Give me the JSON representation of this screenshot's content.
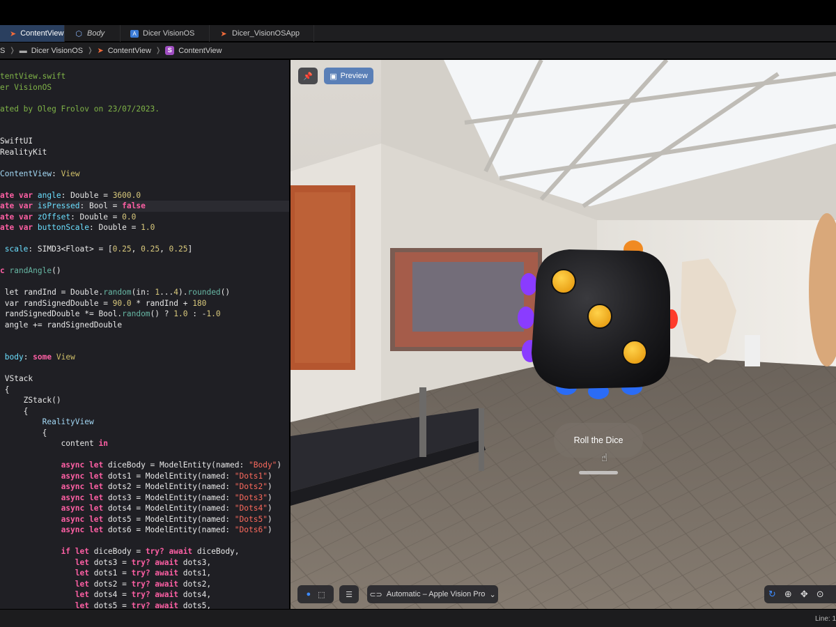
{
  "tabs": [
    {
      "label": "ContentView",
      "icon": "swift-file-icon",
      "active": true
    },
    {
      "label": "Body",
      "icon": "cube-icon",
      "active": false
    },
    {
      "label": "Dicer VisionOS",
      "icon": "app-project-icon",
      "active": false
    },
    {
      "label": "Dicer_VisionOSApp",
      "icon": "swift-file-icon",
      "active": false
    }
  ],
  "breadcrumb": {
    "first": "S",
    "folder": "Dicer VisionOS",
    "file": "ContentView",
    "symbol_badge": "S",
    "symbol": "ContentView"
  },
  "code_lines": [
    [
      {
        "t": "tentView.swift",
        "c": "cm"
      }
    ],
    [
      {
        "t": "er VisionOS",
        "c": "cm"
      }
    ],
    [],
    [
      {
        "t": "ated by Oleg Frolov on 23/07/2023.",
        "c": "cm"
      }
    ],
    [],
    [],
    [
      {
        "t": "SwiftUI",
        "c": ""
      }
    ],
    [
      {
        "t": "RealityKit",
        "c": ""
      }
    ],
    [],
    [
      {
        "t": "ContentView",
        "c": "tp"
      },
      {
        "t": ": ",
        "c": ""
      },
      {
        "t": "View",
        "c": "ty"
      }
    ],
    [],
    [
      {
        "t": "ate ",
        "c": "kw"
      },
      {
        "t": "var ",
        "c": "kw"
      },
      {
        "t": "angle",
        "c": "pr"
      },
      {
        "t": ": Double = ",
        "c": ""
      },
      {
        "t": "3600.0",
        "c": "nm"
      }
    ],
    [
      {
        "t": "ate ",
        "c": "kw"
      },
      {
        "t": "var ",
        "c": "kw"
      },
      {
        "t": "isPressed",
        "c": "pr"
      },
      {
        "t": ": Bool = ",
        "c": ""
      },
      {
        "t": "false",
        "c": "kw"
      }
    ],
    [
      {
        "t": "ate ",
        "c": "kw"
      },
      {
        "t": "var ",
        "c": "kw"
      },
      {
        "t": "zOffset",
        "c": "pr"
      },
      {
        "t": ": Double = ",
        "c": ""
      },
      {
        "t": "0.0",
        "c": "nm"
      }
    ],
    [
      {
        "t": "ate ",
        "c": "kw"
      },
      {
        "t": "var ",
        "c": "kw"
      },
      {
        "t": "buttonScale",
        "c": "pr"
      },
      {
        "t": ": Double = ",
        "c": ""
      },
      {
        "t": "1.0",
        "c": "nm"
      }
    ],
    [],
    [
      {
        "t": " scale",
        "c": "pr"
      },
      {
        "t": ": SIMD3<Float> = [",
        "c": ""
      },
      {
        "t": "0.25",
        "c": "nm"
      },
      {
        "t": ", ",
        "c": ""
      },
      {
        "t": "0.25",
        "c": "nm"
      },
      {
        "t": ", ",
        "c": ""
      },
      {
        "t": "0.25",
        "c": "nm"
      },
      {
        "t": "]",
        "c": ""
      }
    ],
    [],
    [
      {
        "t": "c ",
        "c": "kw"
      },
      {
        "t": "randAngle",
        "c": "fn"
      },
      {
        "t": "()",
        "c": ""
      }
    ],
    [],
    [
      {
        "t": " let ",
        "c": ""
      },
      {
        "t": "randInd = Double.",
        "c": ""
      },
      {
        "t": "random",
        "c": "fn"
      },
      {
        "t": "(in: ",
        "c": ""
      },
      {
        "t": "1",
        "c": "nm"
      },
      {
        "t": "...",
        "c": ""
      },
      {
        "t": "4",
        "c": "nm"
      },
      {
        "t": ").",
        "c": ""
      },
      {
        "t": "rounded",
        "c": "fn"
      },
      {
        "t": "()",
        "c": ""
      }
    ],
    [
      {
        "t": " var ",
        "c": ""
      },
      {
        "t": "randSignedDouble = ",
        "c": ""
      },
      {
        "t": "90.0",
        "c": "nm"
      },
      {
        "t": " * randInd + ",
        "c": ""
      },
      {
        "t": "180",
        "c": "nm"
      }
    ],
    [
      {
        "t": " randSignedDouble *= Bool.",
        "c": ""
      },
      {
        "t": "random",
        "c": "fn"
      },
      {
        "t": "() ? ",
        "c": ""
      },
      {
        "t": "1.0",
        "c": "nm"
      },
      {
        "t": " : -",
        "c": ""
      },
      {
        "t": "1.0",
        "c": "nm"
      }
    ],
    [
      {
        "t": " angle += randSignedDouble",
        "c": ""
      }
    ],
    [],
    [],
    [
      {
        "t": " body",
        "c": "pr"
      },
      {
        "t": ": ",
        "c": ""
      },
      {
        "t": "some ",
        "c": "kw"
      },
      {
        "t": "View",
        "c": "ty"
      }
    ],
    [],
    [
      {
        "t": " VStack",
        "c": ""
      }
    ],
    [
      {
        "t": " {",
        "c": ""
      }
    ],
    [
      {
        "t": "     ZStack()",
        "c": ""
      }
    ],
    [
      {
        "t": "     {",
        "c": ""
      }
    ],
    [
      {
        "t": "         RealityView",
        "c": "tp"
      }
    ],
    [
      {
        "t": "         {",
        "c": ""
      }
    ],
    [
      {
        "t": "             content ",
        "c": ""
      },
      {
        "t": "in",
        "c": "kw"
      }
    ],
    [],
    [
      {
        "t": "             ",
        "c": ""
      },
      {
        "t": "async let ",
        "c": "kw"
      },
      {
        "t": "diceBody = ModelEntity(named: ",
        "c": ""
      },
      {
        "t": "\"Body\"",
        "c": "str"
      },
      {
        "t": ")",
        "c": ""
      }
    ],
    [
      {
        "t": "             ",
        "c": ""
      },
      {
        "t": "async let ",
        "c": "kw"
      },
      {
        "t": "dots1 = ModelEntity(named: ",
        "c": ""
      },
      {
        "t": "\"Dots1\"",
        "c": "str"
      },
      {
        "t": ")",
        "c": ""
      }
    ],
    [
      {
        "t": "             ",
        "c": ""
      },
      {
        "t": "async let ",
        "c": "kw"
      },
      {
        "t": "dots2 = ModelEntity(named: ",
        "c": ""
      },
      {
        "t": "\"Dots2\"",
        "c": "str"
      },
      {
        "t": ")",
        "c": ""
      }
    ],
    [
      {
        "t": "             ",
        "c": ""
      },
      {
        "t": "async let ",
        "c": "kw"
      },
      {
        "t": "dots3 = ModelEntity(named: ",
        "c": ""
      },
      {
        "t": "\"Dots3\"",
        "c": "str"
      },
      {
        "t": ")",
        "c": ""
      }
    ],
    [
      {
        "t": "             ",
        "c": ""
      },
      {
        "t": "async let ",
        "c": "kw"
      },
      {
        "t": "dots4 = ModelEntity(named: ",
        "c": ""
      },
      {
        "t": "\"Dots4\"",
        "c": "str"
      },
      {
        "t": ")",
        "c": ""
      }
    ],
    [
      {
        "t": "             ",
        "c": ""
      },
      {
        "t": "async let ",
        "c": "kw"
      },
      {
        "t": "dots5 = ModelEntity(named: ",
        "c": ""
      },
      {
        "t": "\"Dots5\"",
        "c": "str"
      },
      {
        "t": ")",
        "c": ""
      }
    ],
    [
      {
        "t": "             ",
        "c": ""
      },
      {
        "t": "async let ",
        "c": "kw"
      },
      {
        "t": "dots6 = ModelEntity(named: ",
        "c": ""
      },
      {
        "t": "\"Dots6\"",
        "c": "str"
      },
      {
        "t": ")",
        "c": ""
      }
    ],
    [],
    [
      {
        "t": "             ",
        "c": ""
      },
      {
        "t": "if let ",
        "c": "kw"
      },
      {
        "t": "diceBody = ",
        "c": ""
      },
      {
        "t": "try? await ",
        "c": "kw"
      },
      {
        "t": "diceBody,",
        "c": ""
      }
    ],
    [
      {
        "t": "                ",
        "c": ""
      },
      {
        "t": "let ",
        "c": "kw"
      },
      {
        "t": "dots3 = ",
        "c": ""
      },
      {
        "t": "try? await ",
        "c": "kw"
      },
      {
        "t": "dots3,",
        "c": ""
      }
    ],
    [
      {
        "t": "                ",
        "c": ""
      },
      {
        "t": "let ",
        "c": "kw"
      },
      {
        "t": "dots1 = ",
        "c": ""
      },
      {
        "t": "try? await ",
        "c": "kw"
      },
      {
        "t": "dots1,",
        "c": ""
      }
    ],
    [
      {
        "t": "                ",
        "c": ""
      },
      {
        "t": "let ",
        "c": "kw"
      },
      {
        "t": "dots2 = ",
        "c": ""
      },
      {
        "t": "try? await ",
        "c": "kw"
      },
      {
        "t": "dots2,",
        "c": ""
      }
    ],
    [
      {
        "t": "                ",
        "c": ""
      },
      {
        "t": "let ",
        "c": "kw"
      },
      {
        "t": "dots4 = ",
        "c": ""
      },
      {
        "t": "try? await ",
        "c": "kw"
      },
      {
        "t": "dots4,",
        "c": ""
      }
    ],
    [
      {
        "t": "                ",
        "c": ""
      },
      {
        "t": "let ",
        "c": "kw"
      },
      {
        "t": "dots5 = ",
        "c": ""
      },
      {
        "t": "try? await ",
        "c": "kw"
      },
      {
        "t": "dots5,",
        "c": ""
      }
    ]
  ],
  "highlighted_line": 12,
  "preview": {
    "pin_icon": "pin-icon",
    "preview_label": "Preview",
    "roll_button_label": "Roll the Dice",
    "device_label": "Automatic – Apple Vision Pro",
    "dice_color": "#1c1c1e",
    "pip_color": "#f5b323"
  },
  "status": {
    "line_label": "Line: 1"
  },
  "colors": {
    "accent": "#5a7fb7",
    "active_tab": "#2a3f5f"
  }
}
